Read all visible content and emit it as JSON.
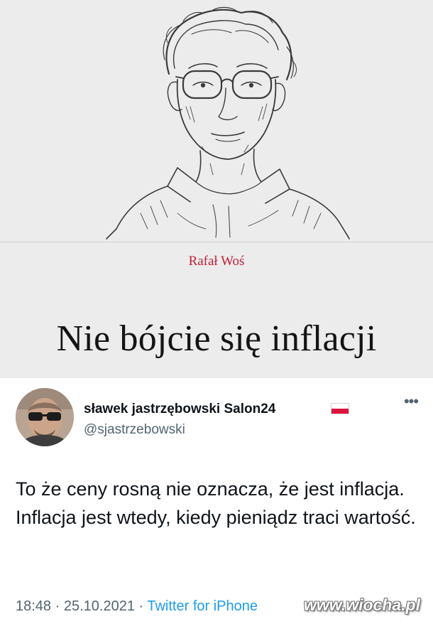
{
  "article": {
    "author": "Rafał Woś",
    "headline": "Nie bójcie się inflacji",
    "author_color": "#c0203a",
    "background": "#ececec"
  },
  "tweet": {
    "display_name": "sławek jastrzębowski Salon24",
    "handle": "@sjastrzebowski",
    "flag_icon": "poland-flag-icon",
    "more_icon": "more-options-icon",
    "text": "To że ceny rosną nie oznacza, że jest inflacja. Inflacja jest wtedy, kiedy pieniądz traci wartość.",
    "time": "18:48",
    "separator": " · ",
    "date": "25.10.2021",
    "source": "Twitter for iPhone",
    "link_color": "#1d9bf0"
  },
  "watermark": {
    "text": "www.wiocha.pl"
  }
}
